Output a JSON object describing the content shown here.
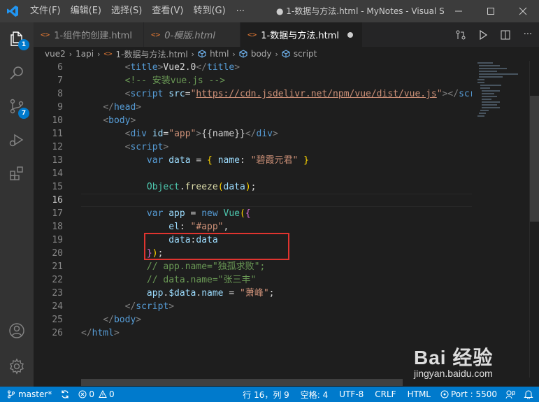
{
  "menu": [
    "文件(F)",
    "编辑(E)",
    "选择(S)",
    "查看(V)",
    "转到(G)"
  ],
  "menu_more": "···",
  "window_title": "● 1-数据与方法.html - MyNotes - Visual St...",
  "tabs": [
    {
      "label": "1-组件的创建.html"
    },
    {
      "label": "0-模版.html"
    },
    {
      "label": "1-数据与方法.html"
    }
  ],
  "breadcrumb": [
    "vue2",
    "1api",
    "1-数据与方法.html",
    "html",
    "body",
    "script"
  ],
  "badges": {
    "explorer": "1",
    "scm": "7"
  },
  "line_numbers": [
    "6",
    "7",
    "8",
    "9",
    "10",
    "11",
    "12",
    "13",
    "14",
    "15",
    "16",
    "17",
    "18",
    "19",
    "20",
    "21",
    "22",
    "23",
    "24",
    "25",
    "26"
  ],
  "code": {
    "l6": {
      "title_text": "Vue2.0"
    },
    "l7": {
      "comment": "<!-- 安装vue.js -->"
    },
    "l8": {
      "url": "https://cdn.jsdelivr.net/npm/vue/dist/vue.js"
    },
    "l11": {
      "id_value": "\"app\"",
      "mustache": "name"
    },
    "l13": {
      "string": "\"碧霞元君\""
    },
    "l15": {
      "obj": "Object",
      "fn": "freeze",
      "arg": "data"
    },
    "l17": {
      "cls": "Vue"
    },
    "l18": {
      "string": "\"#app\""
    },
    "l21": {
      "comment": "// app.name=\"独孤求败\";"
    },
    "l22": {
      "comment": "// data.name=\"张三丰\""
    },
    "l23": {
      "string": "\"萧峰\""
    }
  },
  "status": {
    "branch": "master*",
    "errors": "0",
    "warnings": "0",
    "position": "行 16，列 9",
    "spaces": "空格: 4",
    "encoding": "UTF-8",
    "eol": "CRLF",
    "language": "HTML",
    "port": "Port : 5500"
  },
  "watermark": {
    "brand": "Bai 经验",
    "url": "jingyan.baidu.com"
  },
  "colors": {
    "accent": "#007acc",
    "highlight_box": "#e0342f"
  }
}
